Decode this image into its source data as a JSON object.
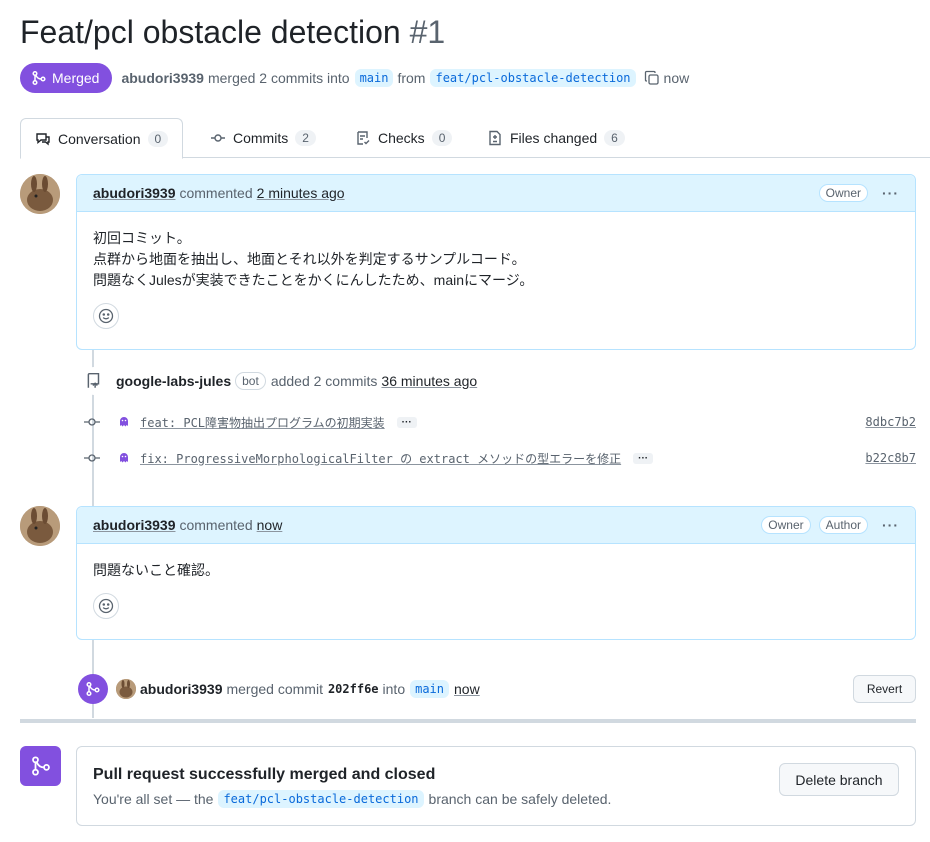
{
  "pr": {
    "title": "Feat/pcl obstacle detection",
    "number": "#1",
    "status_label": "Merged",
    "author": "abudori3939",
    "merge_text": "merged 2 commits into",
    "base_branch": "main",
    "from_text": "from",
    "head_branch": "feat/pcl-obstacle-detection",
    "time": "now"
  },
  "tabs": [
    {
      "label": "Conversation",
      "count": "0"
    },
    {
      "label": "Commits",
      "count": "2"
    },
    {
      "label": "Checks",
      "count": "0"
    },
    {
      "label": "Files changed",
      "count": "6"
    }
  ],
  "comment1": {
    "author": "abudori3939",
    "verb": "commented",
    "time": "2 minutes ago",
    "role": "Owner",
    "lines": [
      "初回コミット。",
      "点群から地面を抽出し、地面とそれ以外を判定するサンプルコード。",
      "問題なくJulesが実装できたことをかくにんしたため、mainにマージ。"
    ]
  },
  "commits_event": {
    "author": "google-labs-jules",
    "badge": "bot",
    "text": "added 2 commits",
    "time": "36 minutes ago",
    "commits": [
      {
        "message": "feat: PCL障害物抽出プログラムの初期実装",
        "sha": "8dbc7b2"
      },
      {
        "message": "fix: ProgressiveMorphologicalFilter の extract メソッドの型エラーを修正",
        "sha": "b22c8b7"
      }
    ]
  },
  "comment2": {
    "author": "abudori3939",
    "verb": "commented",
    "time": "now",
    "role1": "Owner",
    "role2": "Author",
    "text": "問題ないこと確認。"
  },
  "merge_event": {
    "author": "abudori3939",
    "text": "merged commit",
    "sha": "202ff6e",
    "into": "into",
    "branch": "main",
    "time": "now",
    "revert_label": "Revert"
  },
  "merged_box": {
    "heading": "Pull request successfully merged and closed",
    "prefix": "You're all set — the",
    "branch": "feat/pcl-obstacle-detection",
    "suffix": "branch can be safely deleted.",
    "delete_label": "Delete branch"
  },
  "colors": {
    "merged": "#8250df",
    "link": "#0969da",
    "comment_header": "#ddf4ff"
  },
  "icons": [
    "git-merge-icon",
    "copy-icon",
    "comment-icon",
    "commit-icon",
    "checklist-icon",
    "file-diff-icon",
    "smiley-icon",
    "repo-push-icon",
    "jules-icon",
    "kebab-icon"
  ]
}
